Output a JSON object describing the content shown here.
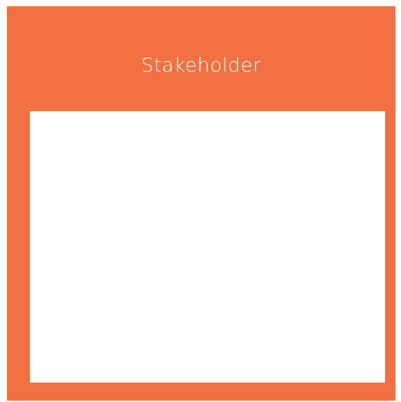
{
  "card": {
    "title": "Stakeholder"
  },
  "colors": {
    "card_background": "#f37042",
    "panel_background": "#ffffff",
    "title_text": "#ffffff"
  }
}
